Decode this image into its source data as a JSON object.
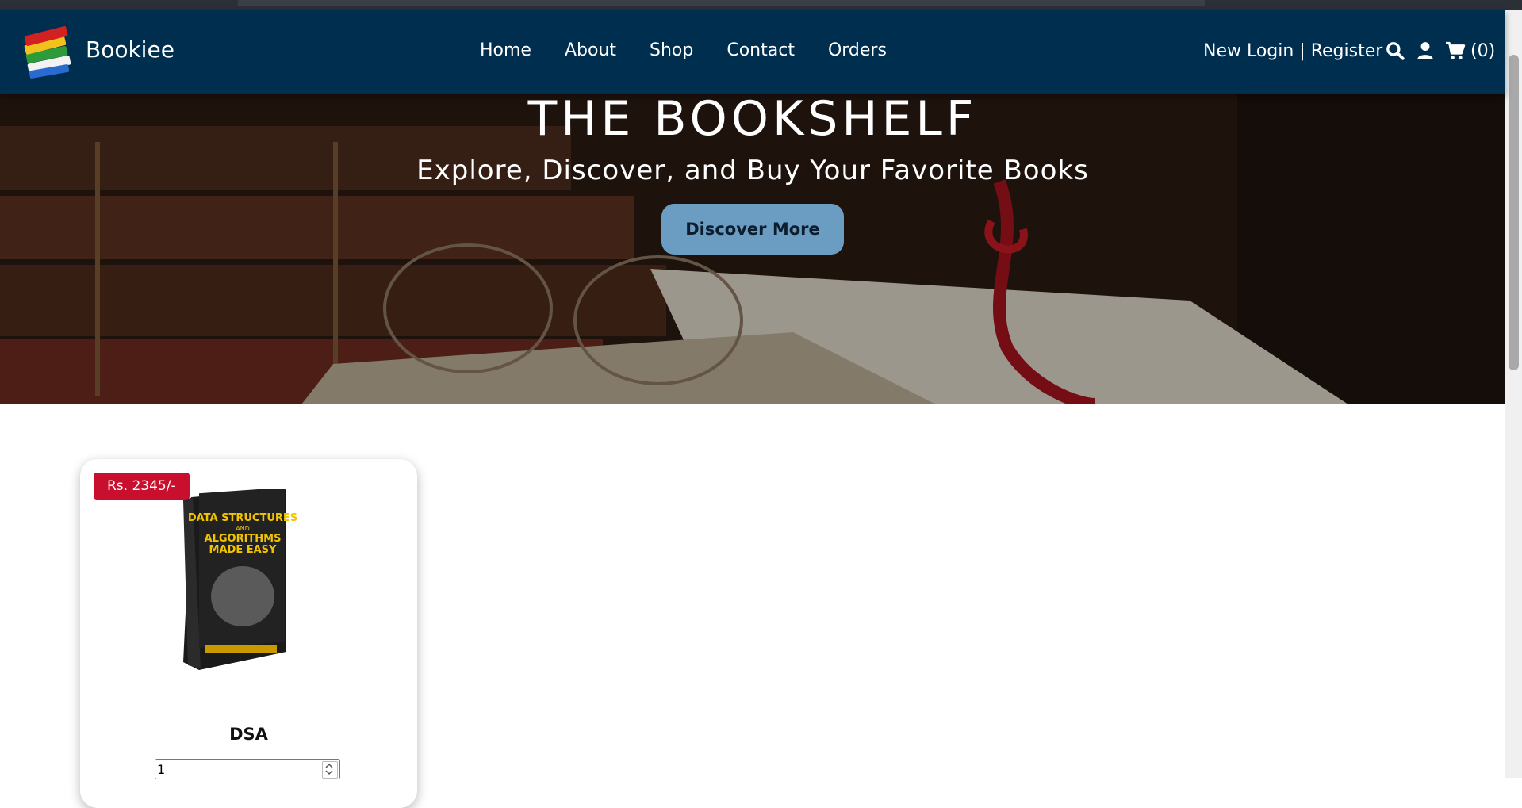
{
  "brand": {
    "name": "Bookiee"
  },
  "nav": {
    "items": [
      {
        "label": "Home"
      },
      {
        "label": "About"
      },
      {
        "label": "Shop"
      },
      {
        "label": "Contact"
      },
      {
        "label": "Orders"
      }
    ],
    "auth_label": "New Login | Register",
    "cart_count": "(0)"
  },
  "hero": {
    "title": "THE BOOKSHELF",
    "subtitle": "Explore, Discover, and Buy Your Favorite Books",
    "button_label": "Discover More"
  },
  "products": [
    {
      "price": "Rs. 2345/-",
      "name": "DSA",
      "quantity": "1",
      "cover_lines": [
        "DATA STRUCTURES",
        "AND",
        "ALGORITHMS",
        "MADE EASY"
      ]
    }
  ],
  "colors": {
    "nav_bg": "#002e4e",
    "button_bg": "#6b9dc2",
    "price_badge": "#c8102e"
  }
}
